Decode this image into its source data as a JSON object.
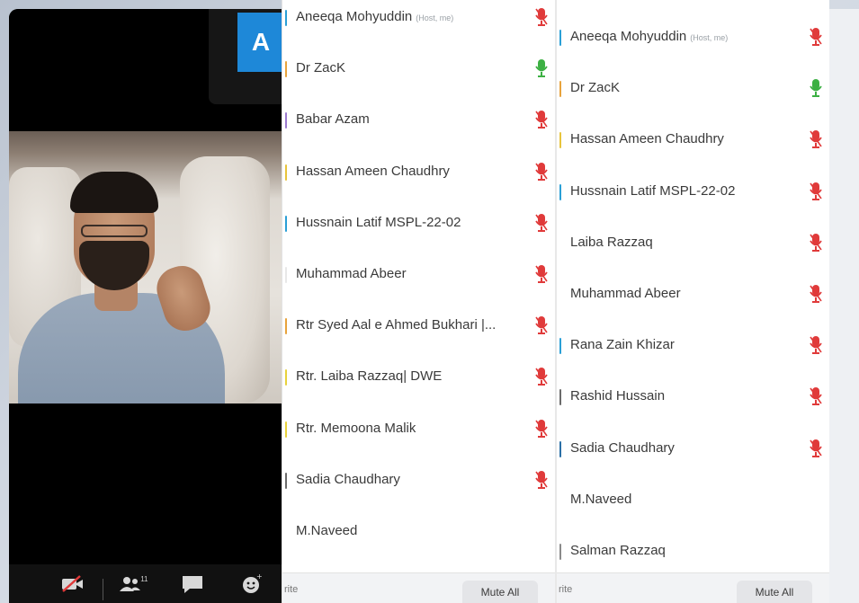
{
  "video": {
    "avatar_letter": "A"
  },
  "panel_left": {
    "participants": [
      {
        "name": "Aneeqa Mohyuddin",
        "tag": "(Host, me)",
        "bar": "#2a9fd6",
        "mic": "muted"
      },
      {
        "name": "Dr ZacK",
        "tag": "",
        "bar": "#e8a33c",
        "mic": "active"
      },
      {
        "name": "Babar Azam",
        "tag": "",
        "bar": "#9c7bd0",
        "mic": "muted"
      },
      {
        "name": "Hassan Ameen Chaudhry",
        "tag": "",
        "bar": "#e8c43c",
        "mic": "muted"
      },
      {
        "name": "Hussnain Latif   MSPL-22-02",
        "tag": "",
        "bar": "#2a9fd6",
        "mic": "muted"
      },
      {
        "name": "Muhammad Abeer",
        "tag": "",
        "bar": "#e8e8e8",
        "mic": "muted"
      },
      {
        "name": "Rtr Syed Aal e Ahmed Bukhari |...",
        "tag": "",
        "bar": "#e8a33c",
        "mic": "muted"
      },
      {
        "name": "Rtr. Laiba Razzaq| DWE",
        "tag": "",
        "bar": "#e8d23c",
        "mic": "muted"
      },
      {
        "name": "Rtr. Memoona Malik",
        "tag": "",
        "bar": "#e8d23c",
        "mic": "muted"
      },
      {
        "name": "Sadia Chaudhary",
        "tag": "",
        "bar": "#6b6b6b",
        "mic": "muted"
      },
      {
        "name": "M.Naveed",
        "tag": "",
        "bar": "#ffffff",
        "mic": "none"
      }
    ],
    "bottom_text": "rite",
    "mute_all": "Mute All"
  },
  "panel_right": {
    "participants": [
      {
        "name": "Aneeqa Mohyuddin",
        "tag": "(Host, me)",
        "bar": "#2a9fd6",
        "mic": "muted"
      },
      {
        "name": "Dr ZacK",
        "tag": "",
        "bar": "#e8a33c",
        "mic": "active"
      },
      {
        "name": "Hassan Ameen Chaudhry",
        "tag": "",
        "bar": "#e8c43c",
        "mic": "muted"
      },
      {
        "name": "Hussnain Latif   MSPL-22-02",
        "tag": "",
        "bar": "#2a9fd6",
        "mic": "muted"
      },
      {
        "name": "Laiba Razzaq",
        "tag": "",
        "bar": "#ffffff",
        "mic": "muted"
      },
      {
        "name": "Muhammad Abeer",
        "tag": "",
        "bar": "#ffffff",
        "mic": "muted"
      },
      {
        "name": "Rana Zain Khizar",
        "tag": "",
        "bar": "#2a9fd6",
        "mic": "muted"
      },
      {
        "name": "Rashid Hussain",
        "tag": "",
        "bar": "#6b6b6b",
        "mic": "muted"
      },
      {
        "name": "Sadia Chaudhary",
        "tag": "",
        "bar": "#2a6fa6",
        "mic": "muted"
      },
      {
        "name": "M.Naveed",
        "tag": "",
        "bar": "#ffffff",
        "mic": "none"
      },
      {
        "name": "Salman Razzaq",
        "tag": "",
        "bar": "#8a8a8a",
        "mic": "none"
      }
    ],
    "bottom_text": "rite",
    "mute_all": "Mute All"
  },
  "colors": {
    "mic_muted": "#e03a3a",
    "mic_active": "#3cb043",
    "avatar_bg": "#1e88d8"
  },
  "toolbar": {
    "participants_count": "11"
  }
}
